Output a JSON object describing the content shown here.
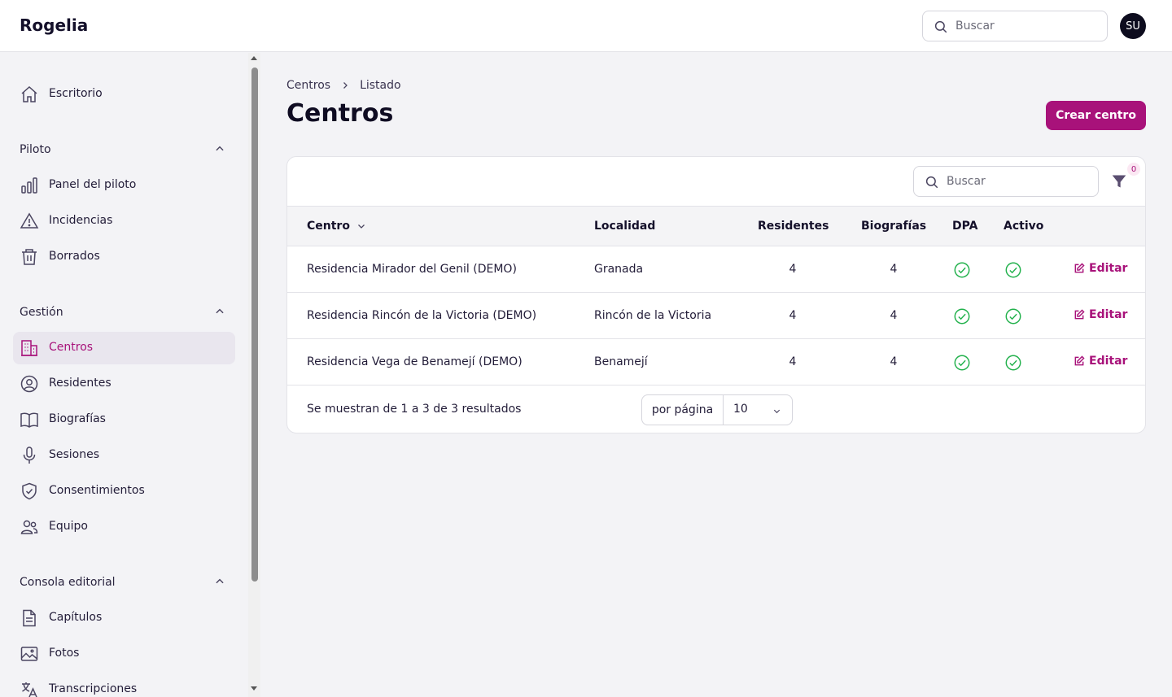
{
  "app": {
    "brand": "Rogelia",
    "search_placeholder": "Buscar",
    "avatar_initials": "SU"
  },
  "sidebar": {
    "top": {
      "label": "Escritorio",
      "icon": "home-icon"
    },
    "groups": [
      {
        "title": "Piloto",
        "items": [
          {
            "label": "Panel del piloto",
            "icon": "chart-bar-icon"
          },
          {
            "label": "Incidencias",
            "icon": "warning-icon"
          },
          {
            "label": "Borrados",
            "icon": "trash-icon"
          }
        ]
      },
      {
        "title": "Gestión",
        "items": [
          {
            "label": "Centros",
            "icon": "building-icon",
            "active": true
          },
          {
            "label": "Residentes",
            "icon": "user-circle-icon"
          },
          {
            "label": "Biografías",
            "icon": "book-icon"
          },
          {
            "label": "Sesiones",
            "icon": "microphone-icon"
          },
          {
            "label": "Consentimientos",
            "icon": "shield-check-icon"
          },
          {
            "label": "Equipo",
            "icon": "users-icon"
          }
        ]
      },
      {
        "title": "Consola editorial",
        "items": [
          {
            "label": "Capítulos",
            "icon": "document-icon"
          },
          {
            "label": "Fotos",
            "icon": "photo-icon"
          },
          {
            "label": "Transcripciones",
            "icon": "language-icon"
          }
        ]
      }
    ]
  },
  "breadcrumb": {
    "parent": "Centros",
    "current": "Listado"
  },
  "page": {
    "title": "Centros",
    "create_label": "Crear centro"
  },
  "table": {
    "search_placeholder": "Buscar",
    "filter_count": "0",
    "columns": {
      "centro": "Centro",
      "localidad": "Localidad",
      "residentes": "Residentes",
      "biografias": "Biografías",
      "dpa": "DPA",
      "activo": "Activo"
    },
    "rows": [
      {
        "centro": "Residencia Mirador del Genil (DEMO)",
        "localidad": "Granada",
        "residentes": "4",
        "biografias": "4",
        "dpa": true,
        "activo": true,
        "action": "Editar"
      },
      {
        "centro": "Residencia Rincón de la Victoria (DEMO)",
        "localidad": "Rincón de la Victoria",
        "residentes": "4",
        "biografias": "4",
        "dpa": true,
        "activo": true,
        "action": "Editar"
      },
      {
        "centro": "Residencia Vega de Benamejí (DEMO)",
        "localidad": "Benamejí",
        "residentes": "4",
        "biografias": "4",
        "dpa": true,
        "activo": true,
        "action": "Editar"
      }
    ],
    "summary": "Se muestran de 1 a 3 de 3 resultados",
    "per_page_label": "por página",
    "per_page_value": "10"
  },
  "colors": {
    "accent": "#a8127a",
    "success": "#22b14c"
  }
}
